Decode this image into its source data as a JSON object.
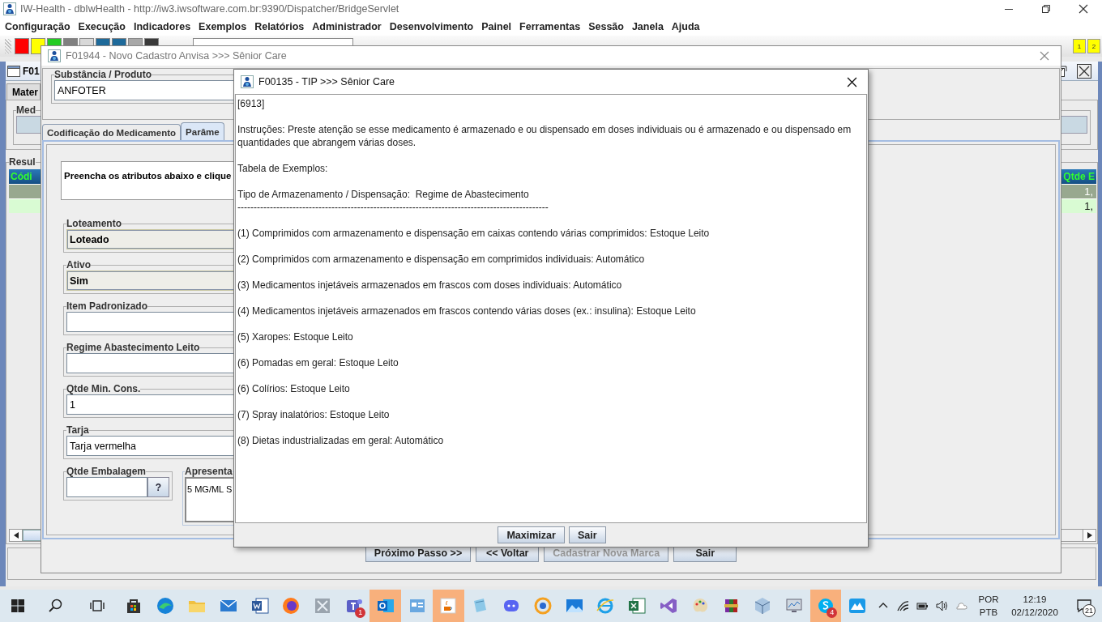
{
  "app_window": {
    "title": "IW-Health - dbIwHealth - http://iw3.iwsoftware.com.br:9390/Dispatcher/BridgeServlet"
  },
  "menu": [
    "Configuração",
    "Execução",
    "Indicadores",
    "Exemplos",
    "Relatórios",
    "Administrador",
    "Desenvolvimento",
    "Painel",
    "Ferramentas",
    "Sessão",
    "Janela",
    "Ajuda"
  ],
  "toolbar": {
    "buttons": [
      {
        "color": "#ff0000"
      },
      {
        "color": "#ffff00"
      },
      {
        "color": "#22cc22"
      },
      {
        "color": "#808080"
      },
      {
        "color": "#d8d8d8"
      },
      {
        "color": "#1e6a9a"
      },
      {
        "color": "#1e6a9a"
      },
      {
        "color": "#a8a8a8"
      },
      {
        "color": "#3a3a3a"
      }
    ],
    "window_buttons": [
      "1",
      "2"
    ]
  },
  "background_frame": {
    "title": "F01",
    "tab": "Mater",
    "group_label": "Med",
    "results_label": "Resul",
    "columns": [
      "Códi",
      "Qtde E"
    ],
    "rows": [
      {
        "selected": true,
        "quantity": "1,"
      },
      {
        "selected": false,
        "quantity": "1,"
      }
    ]
  },
  "form_window": {
    "title": "F01944 - Novo Cadastro Anvisa >>> Sênior Care",
    "substance": {
      "label": "Substância / Produto",
      "value": "ANFOTER"
    },
    "tabs": [
      {
        "label": "Codificação do Medicamento",
        "selected": false
      },
      {
        "label": "Parâme",
        "selected": true
      }
    ],
    "instruction": "Preencha os atributos abaixo e clique",
    "fields": [
      {
        "label": "Loteamento",
        "value": "Loteado",
        "kind": "choice"
      },
      {
        "label": "Ativo",
        "value": "Sim",
        "kind": "choice"
      },
      {
        "label": "Item Padronizado",
        "kind": "text"
      },
      {
        "label": "Regime Abastecimento Leito",
        "kind": "text"
      },
      {
        "label": "Qtde Min. Cons.",
        "value": "1",
        "kind": "text"
      },
      {
        "label": "Tarja",
        "value": "Tarja vermelha",
        "kind": "text"
      }
    ],
    "package": {
      "label": "Qtde Embalagem",
      "help_button": "?"
    },
    "presentation": {
      "label": "Apresenta",
      "value": "5 MG/ML S"
    },
    "buttons": [
      {
        "label": "Próximo Passo >>",
        "disabled": false
      },
      {
        "label": "<< Voltar",
        "disabled": false
      },
      {
        "label": "Cadastrar Nova Marca",
        "disabled": true
      },
      {
        "label": "Sair",
        "disabled": false
      }
    ]
  },
  "dialog": {
    "title": "F00135 - TIP >>> Sênior Care",
    "lines": [
      {
        "kind": "text",
        "text": "[6913]"
      },
      {
        "kind": "text",
        "text": "Instruções: Preste atenção se esse medicamento é armazenado e ou dispensado em doses individuais ou é armazenado e ou dispensado em quantidades que abrangem várias doses."
      },
      {
        "kind": "text",
        "text": "Tabela de Exemplos:"
      },
      {
        "kind": "text",
        "text": "Tipo de Armazenamento / Dispensação:  Regime de Abastecimento"
      },
      {
        "kind": "rule",
        "text": "------------------------------------------------------------------------------------------------"
      },
      {
        "kind": "text",
        "text": "(1) Comprimidos com armazenamento e dispensação em caixas contendo várias comprimidos: Estoque Leito"
      },
      {
        "kind": "text",
        "text": "(2) Comprimidos com armazenamento e dispensação em comprimidos individuais: Automático"
      },
      {
        "kind": "text",
        "text": "(3) Medicamentos injetáveis armazenados em frascos com doses individuais: Automático"
      },
      {
        "kind": "text",
        "text": "(4) Medicamentos injetáveis armazenados em frascos contendo várias doses (ex.: insulina): Estoque Leito"
      },
      {
        "kind": "text",
        "text": "(5) Xaropes: Estoque Leito"
      },
      {
        "kind": "text",
        "text": "(6) Pomadas em geral: Estoque Leito"
      },
      {
        "kind": "text",
        "text": "(6) Colírios: Estoque Leito"
      },
      {
        "kind": "text",
        "text": "(7) Spray inalatórios: Estoque Leito"
      },
      {
        "kind": "text",
        "text": "(8) Dietas industrializadas em geral: Automático"
      }
    ],
    "buttons": [
      "Maximizar",
      "Sair"
    ]
  },
  "taskbar": {
    "apps": [
      {
        "kind": "store",
        "active": false
      },
      {
        "kind": "edge",
        "active": false
      },
      {
        "kind": "files",
        "active": false
      },
      {
        "kind": "mail",
        "active": false
      },
      {
        "kind": "word",
        "active": false
      },
      {
        "kind": "firefox",
        "active": false
      },
      {
        "kind": "tool",
        "active": false
      },
      {
        "kind": "teams",
        "active": false,
        "badge": "1"
      },
      {
        "kind": "outlook",
        "active": true
      },
      {
        "kind": "app",
        "active": false
      },
      {
        "kind": "java",
        "active": true
      },
      {
        "kind": "notepad",
        "active": false
      },
      {
        "kind": "discord",
        "active": false
      },
      {
        "kind": "ring",
        "active": false
      },
      {
        "kind": "photos",
        "active": false
      },
      {
        "kind": "ie",
        "active": false
      },
      {
        "kind": "excel",
        "active": false
      },
      {
        "kind": "vs",
        "active": false
      },
      {
        "kind": "paint",
        "active": false
      },
      {
        "kind": "winrar",
        "active": false
      },
      {
        "kind": "box",
        "active": false
      },
      {
        "kind": "monitor",
        "active": false
      },
      {
        "kind": "skype",
        "active": true,
        "badge": "4"
      },
      {
        "kind": "peak",
        "active": false
      }
    ],
    "language": [
      "POR",
      "PTB"
    ],
    "time": "12:19",
    "date": "02/12/2020",
    "notifications": "21"
  }
}
